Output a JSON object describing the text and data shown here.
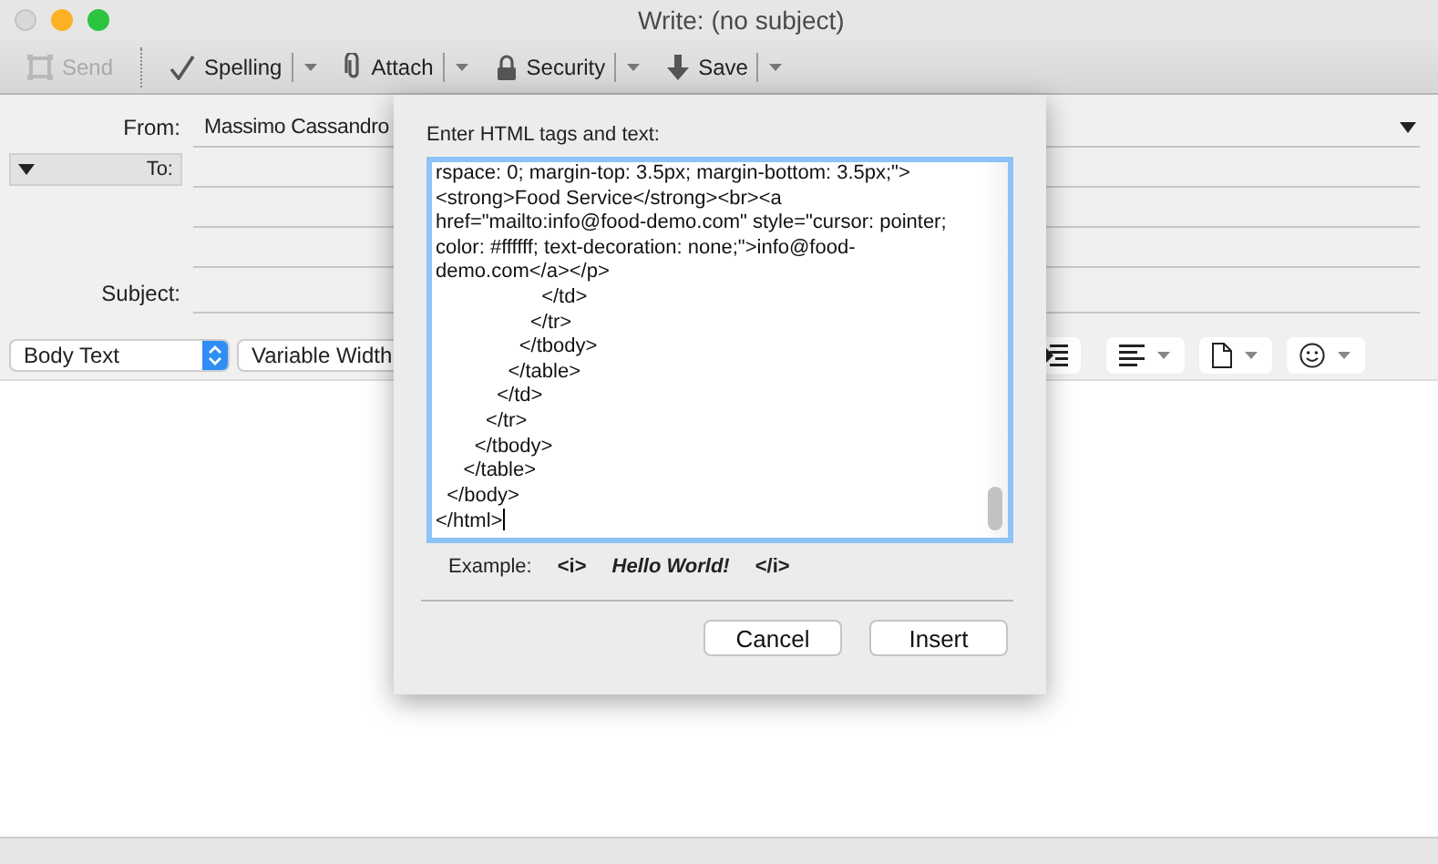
{
  "window": {
    "title": "Write: (no subject)"
  },
  "toolbar": [
    {
      "kind": "send",
      "label": "Send",
      "disabled": true,
      "menu": false
    },
    {
      "kind": "spelling",
      "label": "Spelling",
      "disabled": false,
      "menu": true
    },
    {
      "kind": "attach",
      "label": "Attach",
      "disabled": false,
      "menu": true
    },
    {
      "kind": "security",
      "label": "Security",
      "disabled": false,
      "menu": true
    },
    {
      "kind": "save",
      "label": "Save",
      "disabled": false,
      "menu": true
    }
  ],
  "header": {
    "from_label": "From:",
    "from_value": "Massimo Cassandro",
    "to_label": "To:",
    "subject_label": "Subject:"
  },
  "format_bar": {
    "paragraph_style": "Body Text",
    "font": "Variable Width",
    "tools": [
      {
        "kind": "indent",
        "menu": false
      },
      {
        "kind": "align",
        "menu": true
      },
      {
        "kind": "insert",
        "menu": true
      },
      {
        "kind": "emoji",
        "menu": true
      }
    ]
  },
  "dialog": {
    "prompt": "Enter HTML tags and text:",
    "focused": true,
    "lines": [
      "rspace: 0; margin-top: 3.5px; margin-bottom: 3.5px;\">",
      "<strong>Food Service</strong><br><a",
      "href=\"mailto:info@food-demo.com\" style=\"cursor: pointer;",
      "color: #ffffff; text-decoration: none;\">info@food-",
      "demo.com</a></p>",
      "                   </td>",
      "                 </tr>",
      "               </tbody>",
      "             </table>",
      "           </td>",
      "         </tr>",
      "       </tbody>",
      "     </table>",
      "  </body>",
      "</html>"
    ],
    "example_label": "Example:",
    "example_parts": [
      "<i>",
      "Hello World!",
      "</i>"
    ],
    "buttons": [
      "Cancel",
      "Insert"
    ]
  }
}
